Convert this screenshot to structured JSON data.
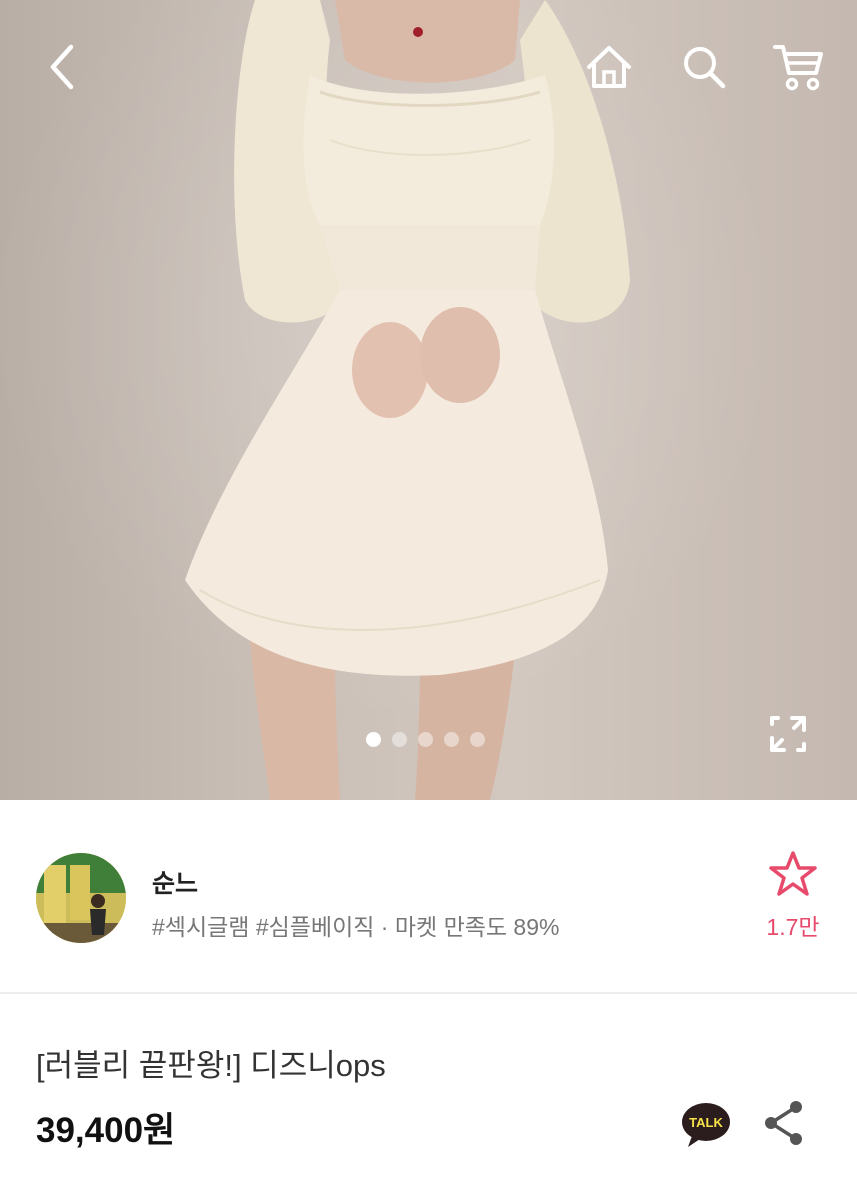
{
  "header": {
    "back_icon": "back-arrow-icon",
    "home_icon": "home-icon",
    "search_icon": "search-icon",
    "cart_icon": "cart-icon"
  },
  "gallery": {
    "image": "product-photo",
    "pages": 5,
    "current_page": 1,
    "expand_icon": "expand-icon"
  },
  "shop": {
    "name": "순느",
    "tags": "#섹시글램 #심플베이직 · 마켓 만족도 89%",
    "favorite_count": "1.7만",
    "favorite_icon": "star-outline-icon",
    "accent_color": "#e84a6c"
  },
  "product": {
    "title": "[러블리 끝판왕!] 디즈니ops",
    "price": "39,400원",
    "talk_label": "TALK",
    "share_icon": "share-icon"
  }
}
